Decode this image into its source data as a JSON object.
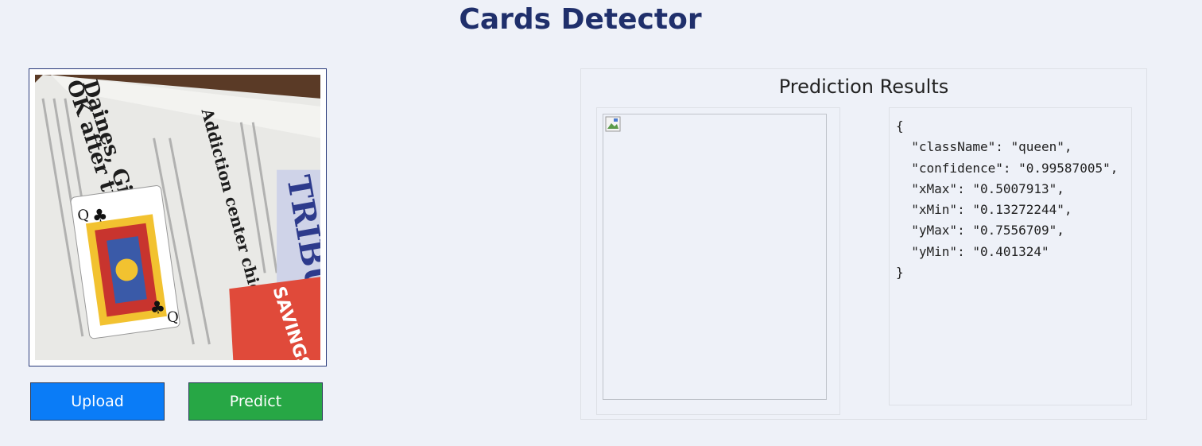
{
  "app": {
    "title": "Cards Detector"
  },
  "upload_panel": {
    "image_alt": "Uploaded photo of a queen of clubs card on a newspaper",
    "upload_label": "Upload",
    "predict_label": "Predict"
  },
  "results": {
    "title": "Prediction Results",
    "json_lines": [
      "{",
      "  \"className\": \"queen\",",
      "  \"confidence\": \"0.99587005\",",
      "  \"xMax\": \"0.5007913\",",
      "  \"xMin\": \"0.13272244\",",
      "  \"yMax\": \"0.7556709\",",
      "  \"yMin\": \"0.401324\"",
      "}"
    ]
  },
  "colors": {
    "title": "#1f2f6b",
    "upload_button": "#0a7cf7",
    "predict_button": "#27a745",
    "background": "#eef1f8"
  }
}
